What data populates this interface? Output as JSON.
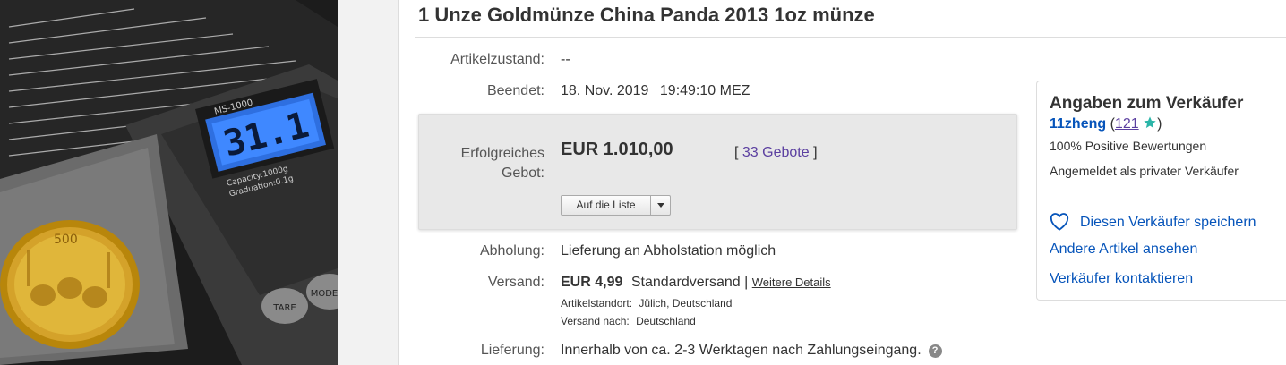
{
  "listing": {
    "title": "1 Unze Goldmünze China Panda 2013 1oz münze"
  },
  "photo": {
    "scale_model": "MS-1000",
    "scale_display": "31.1",
    "scale_capacity": "Capacity:1000g",
    "scale_graduation": "Graduation:0.1g",
    "button_tare": "TARE",
    "button_mode": "MODE",
    "coin_value": "500"
  },
  "details": {
    "condition_label": "Artikelzustand:",
    "condition_value": "--",
    "ended_label": "Beendet:",
    "ended_date": "18. Nov. 2019",
    "ended_time": "19:49:10 MEZ"
  },
  "bid": {
    "label_line1": "Erfolgreiches",
    "label_line2": "Gebot:",
    "price": "EUR 1.010,00",
    "bracket_open": "[",
    "bids_link": "33 Gebote",
    "bracket_close": "]",
    "watch_button": "Auf die Liste"
  },
  "pickup": {
    "label": "Abholung:",
    "value": "Lieferung an Abholstation möglich"
  },
  "shipping": {
    "label": "Versand:",
    "cost": "EUR 4,99",
    "method": "Standardversand",
    "separator": "|",
    "details_link": "Weitere Details",
    "location_label": "Artikelstandort:",
    "location_value": "Jülich, Deutschland",
    "ship_to_label": "Versand nach:",
    "ship_to_value": "Deutschland"
  },
  "delivery": {
    "label": "Lieferung:",
    "value": "Innerhalb von ca. 2-3 Werktagen nach Zahlungseingang.",
    "help_icon": "?"
  },
  "seller": {
    "heading": "Angaben zum Verkäufer",
    "name": "11zheng",
    "paren_open": "(",
    "score": "121",
    "paren_close": ")",
    "positive": "100% Positive Bewertungen",
    "type": "Angemeldet als privater Verkäufer",
    "save_link": "Diesen Verkäufer speichern",
    "other_items_link": "Andere Artikel ansehen",
    "contact_link": "Verkäufer kontaktieren",
    "star_color": "#2bb5a8",
    "link_color": "#0654ba"
  }
}
